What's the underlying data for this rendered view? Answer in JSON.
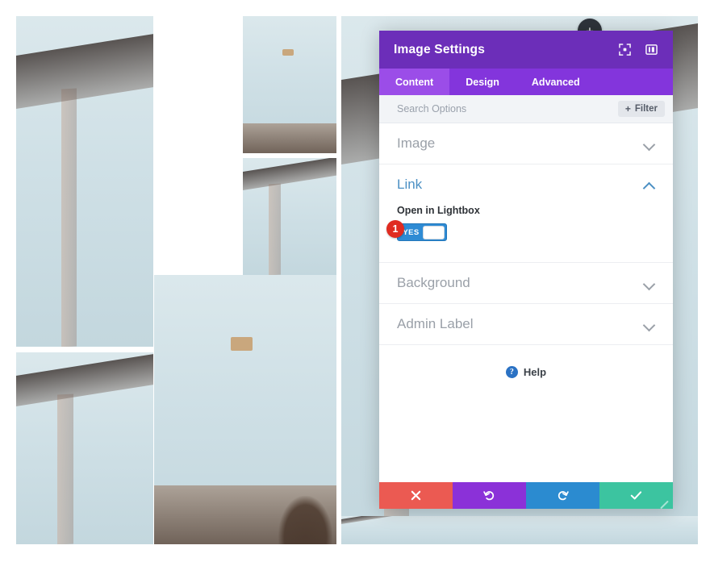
{
  "canvas": {
    "add_module_button_label": "+"
  },
  "gallery": {
    "photos": [
      {
        "name": "ornate-stone-building-corner-large",
        "alt": "Historic ornate stone building corner looking up"
      },
      {
        "name": "ribbed-glass-tower-top",
        "alt": "Modern ribbed glass tower crown"
      },
      {
        "name": "ornate-stone-building-small",
        "alt": "Historic stone building facade"
      },
      {
        "name": "ornate-stone-building-right-tall",
        "alt": "Historic stone building facade tall crop"
      },
      {
        "name": "ornate-stone-building-lower-left",
        "alt": "Historic stone building corner lower left"
      },
      {
        "name": "ribbed-glass-tower-full",
        "alt": "Modern ribbed glass skyscraper full view"
      },
      {
        "name": "ornate-stone-building-bottom-strip",
        "alt": "Historic stone building bottom strip"
      }
    ]
  },
  "panel": {
    "title": "Image Settings",
    "header_icons": [
      {
        "name": "focus-fullscreen-icon",
        "label": "Focus"
      },
      {
        "name": "panel-layout-icon",
        "label": "Layout"
      }
    ],
    "tabs": [
      {
        "label": "Content",
        "active": true
      },
      {
        "label": "Design",
        "active": false
      },
      {
        "label": "Advanced",
        "active": false
      }
    ],
    "search": {
      "placeholder": "Search Options",
      "value": ""
    },
    "filter_button": {
      "plus": "+",
      "label": "Filter"
    },
    "sections": [
      {
        "title": "Image",
        "state": "collapsed"
      },
      {
        "title": "Link",
        "state": "expanded"
      },
      {
        "title": "Background",
        "state": "collapsed"
      },
      {
        "title": "Admin Label",
        "state": "collapsed"
      }
    ],
    "link_section": {
      "field_label": "Open in Lightbox",
      "toggle_value": "YES",
      "badge": "1"
    },
    "help": {
      "icon_glyph": "?",
      "label": "Help"
    },
    "footer_buttons": [
      {
        "name": "cancel-button",
        "glyph": "close-icon",
        "color": "#EB5A52"
      },
      {
        "name": "undo-button",
        "glyph": "undo-icon",
        "color": "#8B31D8"
      },
      {
        "name": "redo-button",
        "glyph": "redo-icon",
        "color": "#2B8BD0"
      },
      {
        "name": "save-button",
        "glyph": "check-icon",
        "color": "#3CC4A0"
      }
    ]
  },
  "colors": {
    "header_purple": "#6C2EB9",
    "tabs_purple": "#8335DC",
    "tab_active_purple": "#9B4DE8",
    "toggle_blue": "#2e8bd4",
    "badge_red": "#e02b20",
    "link_blue": "#4c90c4"
  }
}
